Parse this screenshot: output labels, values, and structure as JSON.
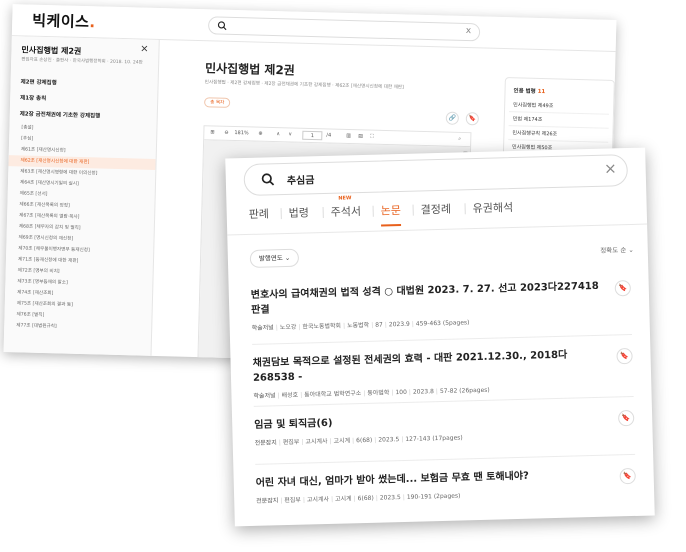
{
  "back_window": {
    "logo": {
      "text": "빅케이스",
      "dot": "."
    },
    "search": {
      "close_icon": "x"
    },
    "sidebar": {
      "title": "민사집행법 제2권",
      "meta": "편집자표 손상진 · 출판사 · 한국사법행정학회 · 2018. 10. 24판",
      "close_icon": "×",
      "toc": [
        {
          "label": "제2편 강제집행",
          "level": 0
        },
        {
          "label": "제1장 총칙",
          "level": 0
        },
        {
          "label": "제2장 금전채권에 기초한 강제집행",
          "level": 0
        },
        {
          "label": "[총설]",
          "level": 1
        },
        {
          "label": "[추심]",
          "level": 1
        },
        {
          "label": "제61조 [재산명시신청]",
          "level": 1
        },
        {
          "label": "제62조 [재산명시신청에 대한 재판]",
          "level": 1,
          "active": true
        },
        {
          "label": "제63조 [재산명시명령에 대한 이의신청]",
          "level": 1
        },
        {
          "label": "제64조 [재산명시기일의 실시]",
          "level": 1
        },
        {
          "label": "제65조 [선서]",
          "level": 1
        },
        {
          "label": "제66조 [재산목록의 정정]",
          "level": 1
        },
        {
          "label": "제67조 [재산목록의 열람·복사]",
          "level": 1
        },
        {
          "label": "제68조 [채무자의 감치 및 벌칙]",
          "level": 1
        },
        {
          "label": "제69조 [명시신청의 재신청]",
          "level": 1
        },
        {
          "label": "제70조 [채무불이행자명부 등재신청]",
          "level": 1
        },
        {
          "label": "제71조 [등재신청에 대한 재판]",
          "level": 1
        },
        {
          "label": "제72조 [명부의 비치]",
          "level": 1
        },
        {
          "label": "제73조 [명부등재의 말소]",
          "level": 1
        },
        {
          "label": "제74조 [재산조회]",
          "level": 1
        },
        {
          "label": "제75조 [재산조회의 결과 등]",
          "level": 1
        },
        {
          "label": "제76조 [벌칙]",
          "level": 1
        },
        {
          "label": "제77조 [대법원규칙]",
          "level": 1
        }
      ]
    },
    "document": {
      "title": "민사집행법 제2권",
      "meta": "민사집행법 · 제2편 강제집행 · 제2장 금전채권에 기초한 강제집행 · 제62조 [재산명시신청에 대한 재판]",
      "chip": "총 목차",
      "link_icon": "🔗",
      "bookmark_icon": "🔖",
      "viewer": {
        "zoom": "181%",
        "page_input": "1",
        "page_total": "/4",
        "grid_icon": "⊞",
        "zoom_out_icon": "⊖",
        "zoom_in_icon": "⊕",
        "prev_icon": "∧",
        "next_icon": "∨",
        "layout_icon_1": "▥",
        "layout_icon_2": "▤",
        "fullscreen_icon": "⛶",
        "search_icon": "⌕"
      }
    },
    "citations": {
      "label": "인용 법령",
      "count": "11",
      "items": [
        "민사집행법 제49조",
        "민법 제174조",
        "민사집행규칙 제26조",
        "민사집행법 제50조",
        "민사집행법 제68조"
      ]
    }
  },
  "front_window": {
    "search": {
      "query": "추심금",
      "clear_icon": "×"
    },
    "tabs": [
      {
        "label": "판례",
        "active": false
      },
      {
        "label": "법령",
        "active": false
      },
      {
        "label": "주석서",
        "active": false,
        "badge": "NEW"
      },
      {
        "label": "논문",
        "active": true
      },
      {
        "label": "결정례",
        "active": false
      },
      {
        "label": "유권해석",
        "active": false
      }
    ],
    "filter": {
      "label": "발행연도",
      "chevron": "⌄"
    },
    "sort": {
      "label": "정확도 순",
      "chevron": "⌄"
    },
    "results": [
      {
        "title": "변호사의 급여채권의 법적 성격 ○ 대법원 2023. 7. 27. 선고 2023다227418 판결",
        "meta": [
          "학술저널",
          "노오강",
          "한국노동법학회",
          "노동법학",
          "87",
          "2023.9",
          "459-463 (5pages)"
        ]
      },
      {
        "title": "채권담보 목적으로 설정된 전세권의 효력 - 대판 2021.12.30., 2018다268538 -",
        "meta": [
          "학술저널",
          "배성호",
          "동아대학교 법학연구소",
          "동아법학",
          "100",
          "2023.8",
          "57-82 (26pages)"
        ]
      },
      {
        "title": "임금 및 퇴직금(6)",
        "meta": [
          "전문잡지",
          "편집부",
          "고시계사",
          "고시계",
          "6(68)",
          "2023.5",
          "127-143 (17pages)"
        ]
      },
      {
        "title": "어린 자녀 대신, 엄마가 받아 썼는데... 보험금 무효 땐 토해내야?",
        "meta": [
          "전문잡지",
          "편집부",
          "고시계사",
          "고시계",
          "6(68)",
          "2023.5",
          "190-191 (2pages)"
        ]
      }
    ],
    "bookmark_icon": "🔖",
    "accent_color": "#e8601c"
  }
}
